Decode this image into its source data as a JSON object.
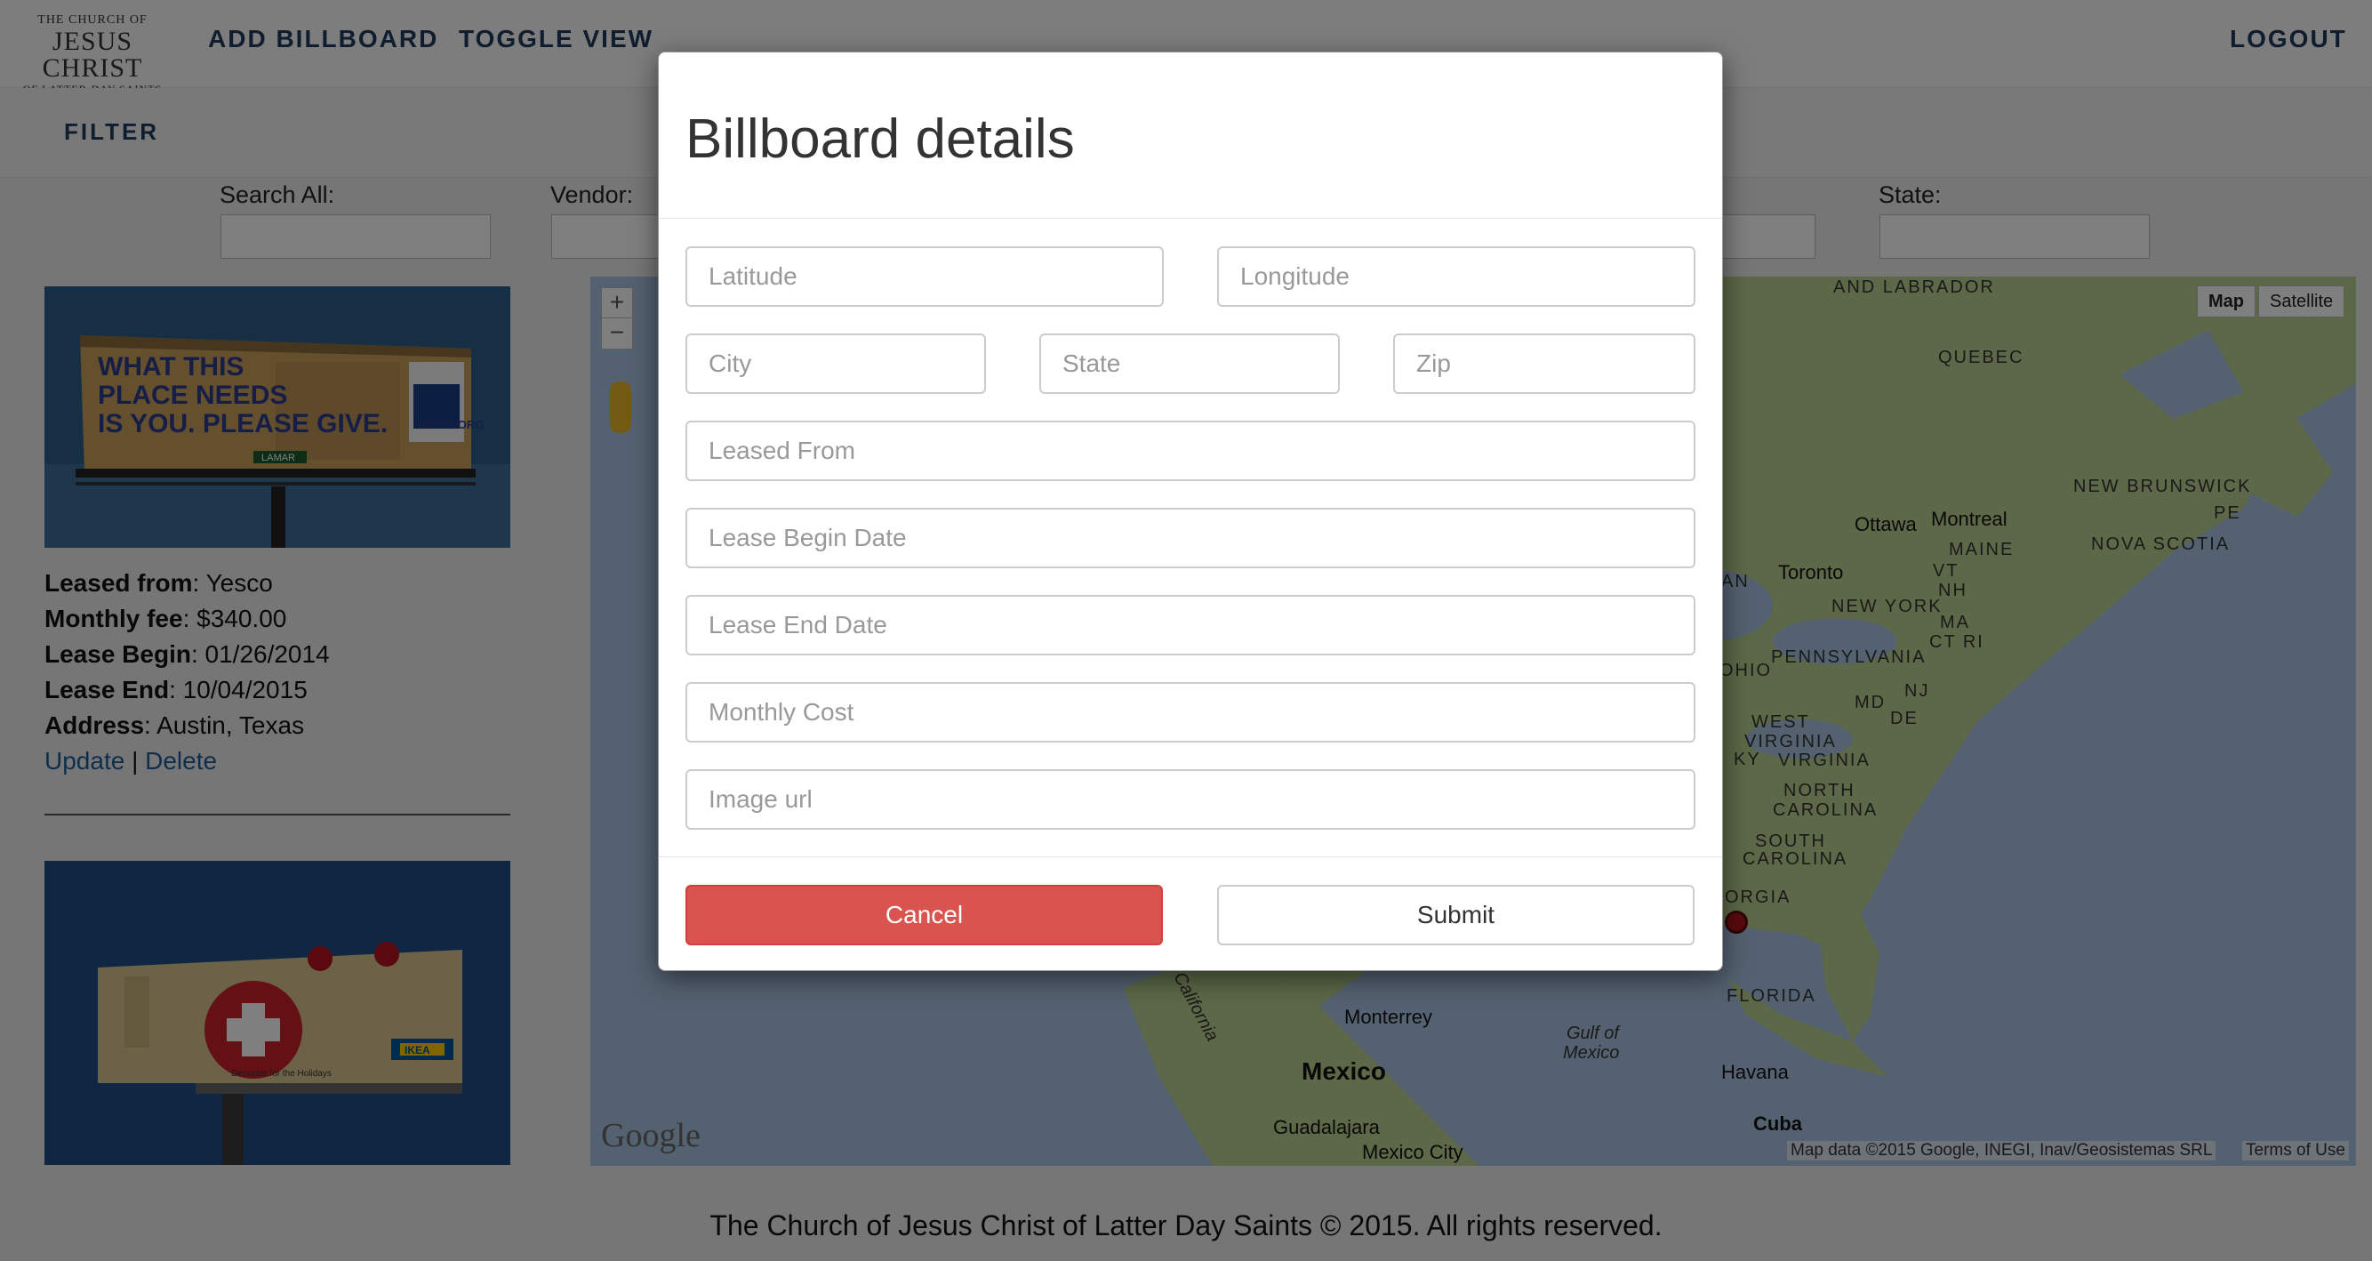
{
  "header": {
    "logo_line1": "THE CHURCH OF",
    "logo_line2": "JESUS CHRIST",
    "logo_line3": "OF LATTER-DAY SAINTS",
    "add_billboard": "ADD BILLBOARD",
    "toggle_view": "TOGGLE VIEW",
    "logout": "LOGOUT"
  },
  "filter": {
    "title": "FILTER",
    "search_all_label": "Search All:",
    "vendor_label": "Vendor:",
    "state_label": "State:"
  },
  "billboards": [
    {
      "image_text": "WHAT THIS PLACE NEEDS IS YOU. PLEASE GIVE.",
      "image_brand": "LAMAR",
      "image_site": "UWGC.ORG",
      "leased_from_label": "Leased from",
      "leased_from": "Yesco",
      "monthly_fee_label": "Monthly fee",
      "monthly_fee": "$340.00",
      "lease_begin_label": "Lease Begin",
      "lease_begin": "01/26/2014",
      "lease_end_label": "Lease End",
      "lease_end": "10/04/2015",
      "address_label": "Address",
      "address": "Austin, Texas",
      "update": "Update",
      "separator": "|",
      "delete": "Delete"
    },
    {
      "image_caption": "Decorate for the Holidays",
      "image_brand": "IKEA"
    }
  ],
  "map": {
    "type_map": "Map",
    "type_satellite": "Satellite",
    "zoom_in": "+",
    "zoom_out": "−",
    "attribution": "Map data ©2015 Google, INEGI, Inav/Geosistemas SRL",
    "terms": "Terms of Use",
    "google": "Google",
    "labels": {
      "labrador": "AND LABRADOR",
      "quebec": "QUEBEC",
      "new_brunswick": "NEW BRUNSWICK",
      "pe": "PE",
      "nova_scotia": "NOVA SCOTIA",
      "maine": "MAINE",
      "vt": "VT",
      "nh": "NH",
      "new_york": "NEW YORK",
      "ma": "MA",
      "ct_ri": "CT RI",
      "pennsylvania": "PENNSYLVANIA",
      "nj": "NJ",
      "ohio": "OHIO",
      "md": "MD",
      "de": "DE",
      "west": "WEST",
      "virginia_w": "VIRGINIA",
      "ky": "KY",
      "virginia": "VIRGINIA",
      "north": "NORTH",
      "carolina_n": "CAROLINA",
      "south": "SOUTH",
      "carolina_s": "CAROLINA",
      "georgia": "ORGIA",
      "florida": "FLORIDA",
      "an": "AN",
      "gulf1": "Gulf of",
      "gulf2": "Mexico",
      "california": "of California"
    },
    "cities": {
      "ottawa": "Ottawa",
      "montreal": "Montreal",
      "toronto": "Toronto",
      "monterrey": "Monterrey",
      "mexico": "Mexico",
      "guadalajara": "Guadalajara",
      "mexico_city": "Mexico City",
      "havana": "Havana",
      "cuba": "Cuba"
    }
  },
  "modal": {
    "title": "Billboard details",
    "latitude_placeholder": "Latitude",
    "longitude_placeholder": "Longitude",
    "city_placeholder": "City",
    "state_placeholder": "State",
    "zip_placeholder": "Zip",
    "leased_from_placeholder": "Leased From",
    "lease_begin_placeholder": "Lease Begin Date",
    "lease_end_placeholder": "Lease End Date",
    "monthly_cost_placeholder": "Monthly Cost",
    "image_url_placeholder": "Image url",
    "cancel": "Cancel",
    "submit": "Submit"
  },
  "footer": {
    "text": "The Church of Jesus Christ of Latter Day Saints © 2015. All rights reserved."
  },
  "colors": {
    "nav": "#203a5c",
    "link": "#1f5d99",
    "cancel": "#d9534f",
    "map_water": "#a9c3e0",
    "map_land": "#b9d08e"
  }
}
